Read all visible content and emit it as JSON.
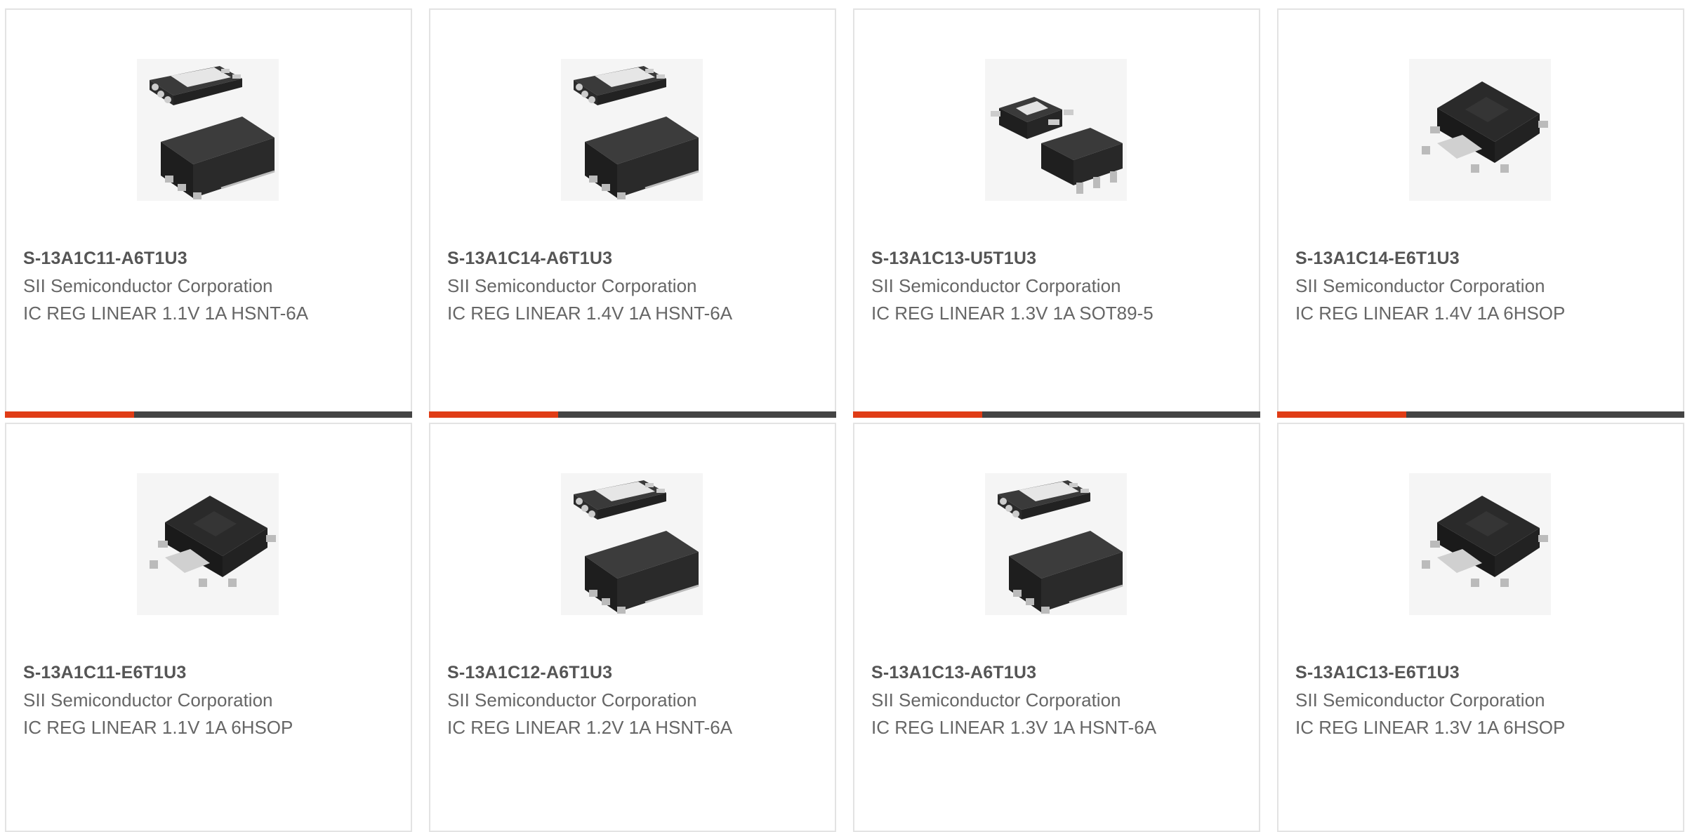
{
  "colors": {
    "accent": "#e03c16",
    "bar": "#444444",
    "border": "#e3e3e3"
  },
  "products": [
    {
      "part_number": "S-13A1C11-A6T1U3",
      "manufacturer": "SII Semiconductor Corporation",
      "description": "IC REG LINEAR 1.1V 1A HSNT-6A",
      "image": "hsnt-package"
    },
    {
      "part_number": "S-13A1C14-A6T1U3",
      "manufacturer": "SII Semiconductor Corporation",
      "description": "IC REG LINEAR 1.4V 1A HSNT-6A",
      "image": "hsnt-package"
    },
    {
      "part_number": "S-13A1C13-U5T1U3",
      "manufacturer": "SII Semiconductor Corporation",
      "description": "IC REG LINEAR 1.3V 1A SOT89-5",
      "image": "sot89-package"
    },
    {
      "part_number": "S-13A1C14-E6T1U3",
      "manufacturer": "SII Semiconductor Corporation",
      "description": "IC REG LINEAR 1.4V 1A 6HSOP",
      "image": "hsop-package"
    },
    {
      "part_number": "S-13A1C11-E6T1U3",
      "manufacturer": "SII Semiconductor Corporation",
      "description": "IC REG LINEAR 1.1V 1A 6HSOP",
      "image": "hsop-package"
    },
    {
      "part_number": "S-13A1C12-A6T1U3",
      "manufacturer": "SII Semiconductor Corporation",
      "description": "IC REG LINEAR 1.2V 1A HSNT-6A",
      "image": "hsnt-package"
    },
    {
      "part_number": "S-13A1C13-A6T1U3",
      "manufacturer": "SII Semiconductor Corporation",
      "description": "IC REG LINEAR 1.3V 1A HSNT-6A",
      "image": "hsnt-package"
    },
    {
      "part_number": "S-13A1C13-E6T1U3",
      "manufacturer": "SII Semiconductor Corporation",
      "description": "IC REG LINEAR 1.3V 1A 6HSOP",
      "image": "hsop-package"
    }
  ]
}
